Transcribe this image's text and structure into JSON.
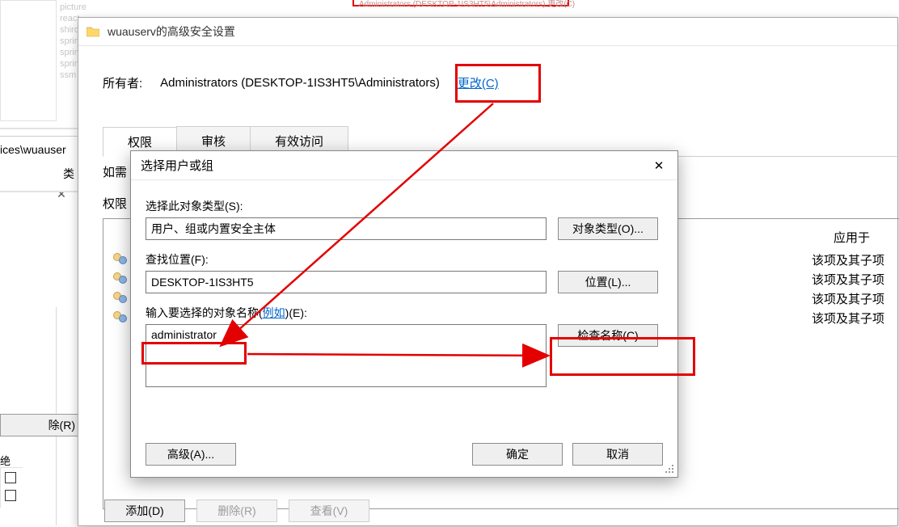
{
  "bg": {
    "items": [
      "picture",
      "react",
      "shiro",
      "sprin",
      "sprin",
      "sprin",
      "ssm"
    ],
    "path_fragment": "ices\\wuauser",
    "type_label": "类",
    "deny_label": "绝",
    "remove_btn": "除(R)",
    "top_owner_frag": "Administrators (DESKTOP-1IS3HT5\\Administrators)  更改(C)"
  },
  "adv": {
    "title": "wuauserv的高级安全设置",
    "owner_label": "所有者:",
    "owner_value": "Administrators (DESKTOP-1IS3HT5\\Administrators)",
    "change_link": "更改(C)",
    "tabs": {
      "perm": "权限",
      "audit": "审核",
      "effective": "有效访问"
    },
    "line1": "如需",
    "line2": "权限",
    "col_applies": "应用于",
    "apply_value": "该项及其子项",
    "buttons": {
      "add": "添加(D)",
      "remove": "删除(R)",
      "view": "查看(V)"
    }
  },
  "sel": {
    "title": "选择用户或组",
    "sections": {
      "type_label": "选择此对象类型(S):",
      "type_value": "用户、组或内置安全主体",
      "type_btn": "对象类型(O)...",
      "loc_label": "查找位置(F):",
      "loc_value": "DESKTOP-1IS3HT5",
      "loc_btn": "位置(L)...",
      "name_label_pre": "输入要选择的对象名称(",
      "name_label_link": "例如",
      "name_label_post": ")(E):",
      "name_value": "administrator",
      "check_btn": "检查名称(C)"
    },
    "footer": {
      "advanced": "高级(A)...",
      "ok": "确定",
      "cancel": "取消"
    }
  }
}
